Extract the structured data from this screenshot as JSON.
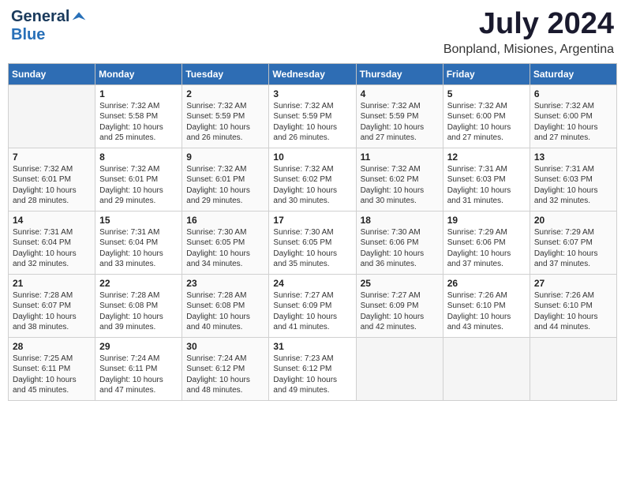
{
  "header": {
    "logo_general": "General",
    "logo_blue": "Blue",
    "month_year": "July 2024",
    "location": "Bonpland, Misiones, Argentina"
  },
  "weekdays": [
    "Sunday",
    "Monday",
    "Tuesday",
    "Wednesday",
    "Thursday",
    "Friday",
    "Saturday"
  ],
  "weeks": [
    [
      {
        "day": "",
        "content": ""
      },
      {
        "day": "1",
        "content": "Sunrise: 7:32 AM\nSunset: 5:58 PM\nDaylight: 10 hours\nand 25 minutes."
      },
      {
        "day": "2",
        "content": "Sunrise: 7:32 AM\nSunset: 5:59 PM\nDaylight: 10 hours\nand 26 minutes."
      },
      {
        "day": "3",
        "content": "Sunrise: 7:32 AM\nSunset: 5:59 PM\nDaylight: 10 hours\nand 26 minutes."
      },
      {
        "day": "4",
        "content": "Sunrise: 7:32 AM\nSunset: 5:59 PM\nDaylight: 10 hours\nand 27 minutes."
      },
      {
        "day": "5",
        "content": "Sunrise: 7:32 AM\nSunset: 6:00 PM\nDaylight: 10 hours\nand 27 minutes."
      },
      {
        "day": "6",
        "content": "Sunrise: 7:32 AM\nSunset: 6:00 PM\nDaylight: 10 hours\nand 27 minutes."
      }
    ],
    [
      {
        "day": "7",
        "content": "Sunrise: 7:32 AM\nSunset: 6:01 PM\nDaylight: 10 hours\nand 28 minutes."
      },
      {
        "day": "8",
        "content": "Sunrise: 7:32 AM\nSunset: 6:01 PM\nDaylight: 10 hours\nand 29 minutes."
      },
      {
        "day": "9",
        "content": "Sunrise: 7:32 AM\nSunset: 6:01 PM\nDaylight: 10 hours\nand 29 minutes."
      },
      {
        "day": "10",
        "content": "Sunrise: 7:32 AM\nSunset: 6:02 PM\nDaylight: 10 hours\nand 30 minutes."
      },
      {
        "day": "11",
        "content": "Sunrise: 7:32 AM\nSunset: 6:02 PM\nDaylight: 10 hours\nand 30 minutes."
      },
      {
        "day": "12",
        "content": "Sunrise: 7:31 AM\nSunset: 6:03 PM\nDaylight: 10 hours\nand 31 minutes."
      },
      {
        "day": "13",
        "content": "Sunrise: 7:31 AM\nSunset: 6:03 PM\nDaylight: 10 hours\nand 32 minutes."
      }
    ],
    [
      {
        "day": "14",
        "content": "Sunrise: 7:31 AM\nSunset: 6:04 PM\nDaylight: 10 hours\nand 32 minutes."
      },
      {
        "day": "15",
        "content": "Sunrise: 7:31 AM\nSunset: 6:04 PM\nDaylight: 10 hours\nand 33 minutes."
      },
      {
        "day": "16",
        "content": "Sunrise: 7:30 AM\nSunset: 6:05 PM\nDaylight: 10 hours\nand 34 minutes."
      },
      {
        "day": "17",
        "content": "Sunrise: 7:30 AM\nSunset: 6:05 PM\nDaylight: 10 hours\nand 35 minutes."
      },
      {
        "day": "18",
        "content": "Sunrise: 7:30 AM\nSunset: 6:06 PM\nDaylight: 10 hours\nand 36 minutes."
      },
      {
        "day": "19",
        "content": "Sunrise: 7:29 AM\nSunset: 6:06 PM\nDaylight: 10 hours\nand 37 minutes."
      },
      {
        "day": "20",
        "content": "Sunrise: 7:29 AM\nSunset: 6:07 PM\nDaylight: 10 hours\nand 37 minutes."
      }
    ],
    [
      {
        "day": "21",
        "content": "Sunrise: 7:28 AM\nSunset: 6:07 PM\nDaylight: 10 hours\nand 38 minutes."
      },
      {
        "day": "22",
        "content": "Sunrise: 7:28 AM\nSunset: 6:08 PM\nDaylight: 10 hours\nand 39 minutes."
      },
      {
        "day": "23",
        "content": "Sunrise: 7:28 AM\nSunset: 6:08 PM\nDaylight: 10 hours\nand 40 minutes."
      },
      {
        "day": "24",
        "content": "Sunrise: 7:27 AM\nSunset: 6:09 PM\nDaylight: 10 hours\nand 41 minutes."
      },
      {
        "day": "25",
        "content": "Sunrise: 7:27 AM\nSunset: 6:09 PM\nDaylight: 10 hours\nand 42 minutes."
      },
      {
        "day": "26",
        "content": "Sunrise: 7:26 AM\nSunset: 6:10 PM\nDaylight: 10 hours\nand 43 minutes."
      },
      {
        "day": "27",
        "content": "Sunrise: 7:26 AM\nSunset: 6:10 PM\nDaylight: 10 hours\nand 44 minutes."
      }
    ],
    [
      {
        "day": "28",
        "content": "Sunrise: 7:25 AM\nSunset: 6:11 PM\nDaylight: 10 hours\nand 45 minutes."
      },
      {
        "day": "29",
        "content": "Sunrise: 7:24 AM\nSunset: 6:11 PM\nDaylight: 10 hours\nand 47 minutes."
      },
      {
        "day": "30",
        "content": "Sunrise: 7:24 AM\nSunset: 6:12 PM\nDaylight: 10 hours\nand 48 minutes."
      },
      {
        "day": "31",
        "content": "Sunrise: 7:23 AM\nSunset: 6:12 PM\nDaylight: 10 hours\nand 49 minutes."
      },
      {
        "day": "",
        "content": ""
      },
      {
        "day": "",
        "content": ""
      },
      {
        "day": "",
        "content": ""
      }
    ]
  ]
}
